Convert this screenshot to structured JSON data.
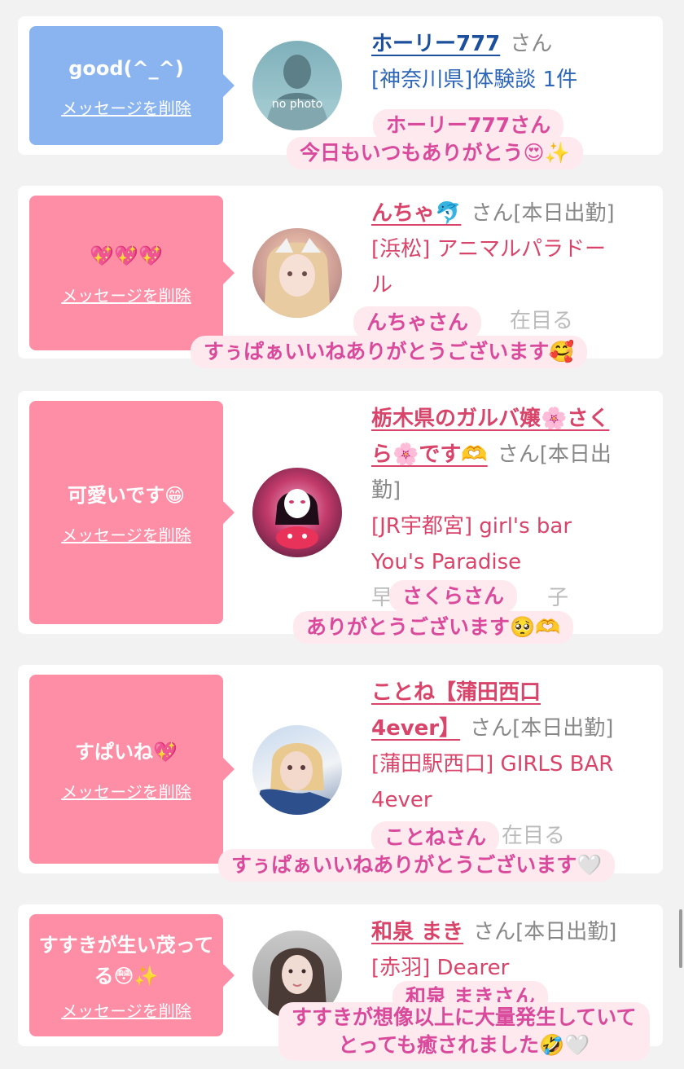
{
  "cards": [
    {
      "bubble_text": "good(^_^)",
      "delete_label": "メッセージを削除",
      "avatar_caption": "no photo",
      "name": "ホーリー777",
      "san": "さん",
      "shop_line1": "[神奈川県]体験談 1件",
      "overlay_name": "ホーリー777さん",
      "overlay_message": "今日もいつもありがとう😍✨"
    },
    {
      "bubble_text": "💖💖💖",
      "delete_label": "メッセージを削除",
      "name": "んちゃ🐬",
      "san": "さん[本日出勤]",
      "shop_line1": "[浜松] アニマルパラドー",
      "shop_line2": "ル",
      "faded_text": "在目る",
      "overlay_name": "んちゃさん",
      "overlay_message": "すぅぱぁいいねありがとうございます🥰"
    },
    {
      "bubble_text": "可愛いです😁",
      "delete_label": "メッセージを削除",
      "name_line1": "栃木県のガルバ嬢🌸さく",
      "name_line2": "ら🌸です🫶",
      "san_line1": "さん[本日出",
      "san_line2": "勤]",
      "shop_line1": "[JR宇都宮] girl's bar",
      "shop_line2": "You's Paradise",
      "faded_text": "早",
      "faded_text2": "子",
      "overlay_name": "さくらさん",
      "overlay_message": "ありがとうございます🥺🫶"
    },
    {
      "bubble_text": "すぱいね💖",
      "delete_label": "メッセージを削除",
      "name_line1": "ことね【蒲田西口",
      "name_line2": "4ever】",
      "san": "さん[本日出勤]",
      "shop_line1": "[蒲田駅西口] GIRLS BAR",
      "shop_line2": "4ever",
      "faded_text": "在目る",
      "overlay_name": "ことねさん",
      "overlay_message": "すぅぱぁいいねありがとうございます🤍"
    },
    {
      "bubble_text": "すすきが生い茂ってる😳✨",
      "delete_label": "メッセージを削除",
      "name": "和泉 まき",
      "san": "さん[本日出勤]",
      "shop_line1": "[赤羽] Dearer",
      "overlay_name": "和泉 まきさん",
      "overlay_message_line1": "すすきが想像以上に大量発生していて",
      "overlay_message_line2": "とっても癒されました🤣🤍"
    }
  ],
  "colors": {
    "blue_bubble": "#8ab4f0",
    "pink_bubble": "#fd8ea6",
    "name_pink": "#d9456a",
    "name_blue": "#1c4f9c",
    "overlay_bg": "#fde9ee",
    "overlay_text": "#d94a9c"
  }
}
